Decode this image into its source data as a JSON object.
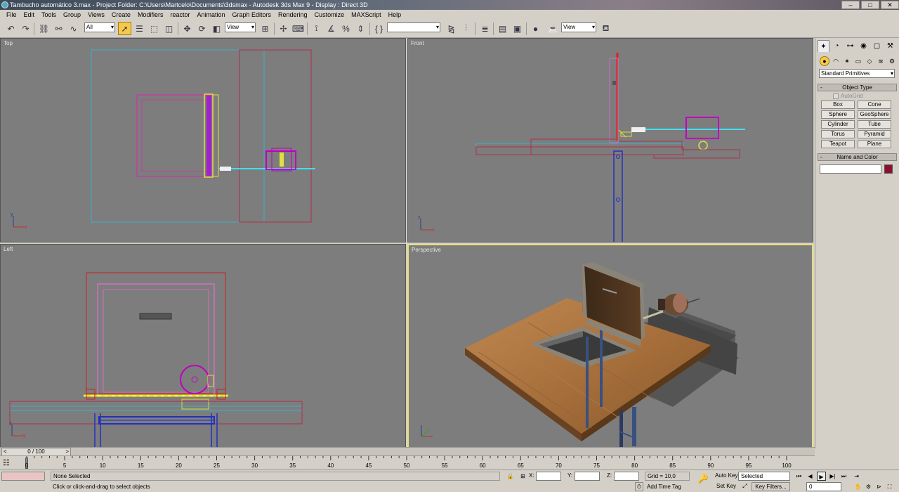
{
  "titlebar": {
    "text": "Tambucho automático 3.max      - Project Folder: C:\\Users\\Martcelo\\Documents\\3dsmax      - Autodesk 3ds Max 9      - Display : Direct 3D"
  },
  "menu": [
    "File",
    "Edit",
    "Tools",
    "Group",
    "Views",
    "Create",
    "Modifiers",
    "reactor",
    "Animation",
    "Graph Editors",
    "Rendering",
    "Customize",
    "MAXScript",
    "Help"
  ],
  "toolbar": {
    "selection_filter": "All",
    "ref_coord": "View",
    "named_selection": "",
    "render_view": "View"
  },
  "viewports": {
    "top": "Top",
    "front": "Front",
    "left": "Left",
    "perspective": "Perspective"
  },
  "command_panel": {
    "category": "Standard Primitives",
    "object_type_title": "Object Type",
    "autogrid": "AutoGrid",
    "buttons": [
      "Box",
      "Cone",
      "Sphere",
      "GeoSphere",
      "Cylinder",
      "Tube",
      "Torus",
      "Pyramid",
      "Teapot",
      "Plane"
    ],
    "name_color_title": "Name and Color",
    "object_color": "#8b1030"
  },
  "time_slider": {
    "label": "0 / 100"
  },
  "trackbar": {
    "ticks": [
      "0",
      "5",
      "10",
      "15",
      "20",
      "25",
      "30",
      "35",
      "40",
      "45",
      "50",
      "55",
      "60",
      "65",
      "70",
      "75",
      "80",
      "85",
      "90",
      "95",
      "100"
    ]
  },
  "status": {
    "selection": "None Selected",
    "prompt": "Click or click-and-drag to select objects",
    "x_label": "X:",
    "y_label": "Y:",
    "z_label": "Z:",
    "grid": "Grid = 10,0",
    "add_time_tag": "Add Time Tag",
    "auto_key": "Auto Key",
    "set_key": "Set Key",
    "key_mode": "Selected",
    "key_filters": "Key Filters...",
    "frame": "0"
  }
}
